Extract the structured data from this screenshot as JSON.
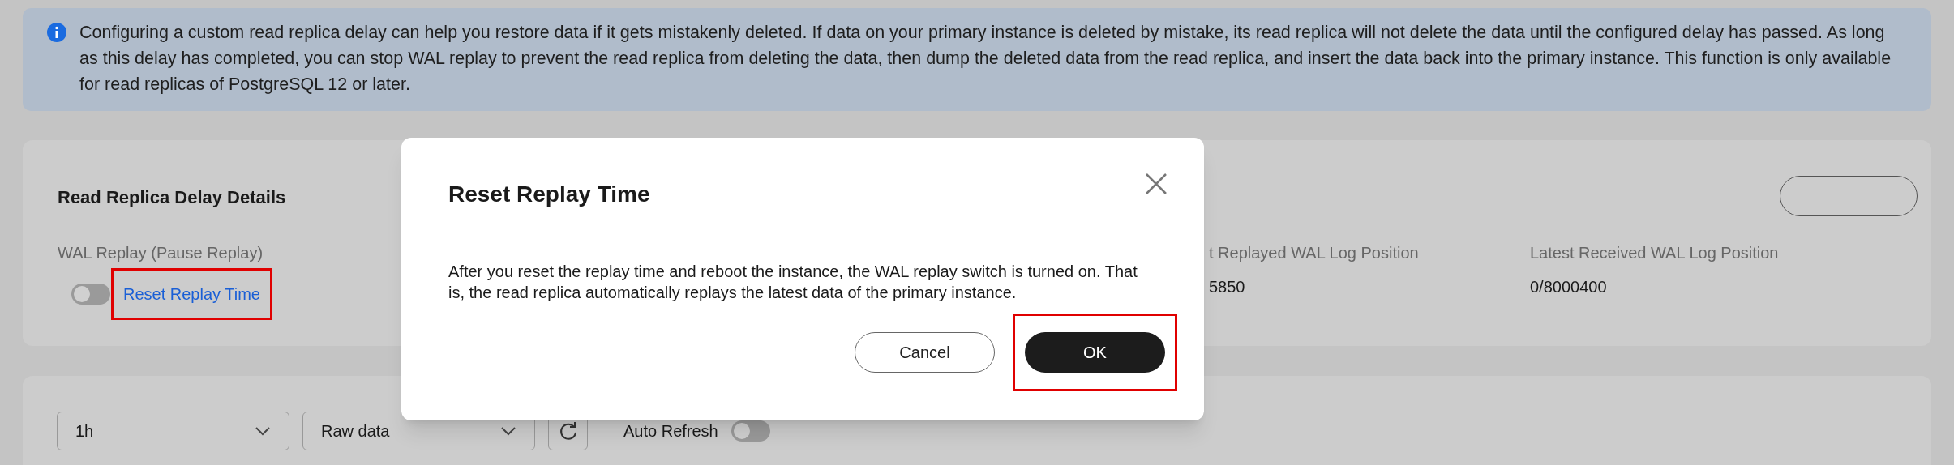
{
  "notice": {
    "text": "Configuring a custom read replica delay can help you restore data if it gets mistakenly deleted. If data on your primary instance is deleted by mistake, its read replica will not delete the data until the configured delay has passed. As long as this delay has completed, you can stop WAL replay to prevent the read replica from deleting the data, then dump the deleted data from the read replica, and insert the data back into the primary instance. This function is only available for read replicas of PostgreSQL 12 or later."
  },
  "details": {
    "title": "Read Replica Delay Details",
    "wal_replay": {
      "label": "WAL Replay (Pause Replay)",
      "on": false,
      "link": "Reset Replay Time",
      "highlighted": true
    },
    "fields": [
      {
        "label": "t Replayed WAL Log Position",
        "value": "5850"
      },
      {
        "label": "Latest Received WAL Log Position",
        "value": "0/8000400"
      }
    ]
  },
  "toolbar": {
    "period": "1h",
    "data_type": "Raw data",
    "auto_refresh": {
      "label": "Auto Refresh",
      "on": false
    }
  },
  "dialog": {
    "title": "Reset Replay Time",
    "body": "After you reset the replay time and reboot the instance, the WAL replay switch is turned on. That is, the read replica automatically replays the latest data of the primary instance.",
    "buttons": [
      {
        "label": "Cancel",
        "kind": "secondary",
        "highlighted": false
      },
      {
        "label": "OK",
        "kind": "primary",
        "highlighted": true
      }
    ]
  }
}
